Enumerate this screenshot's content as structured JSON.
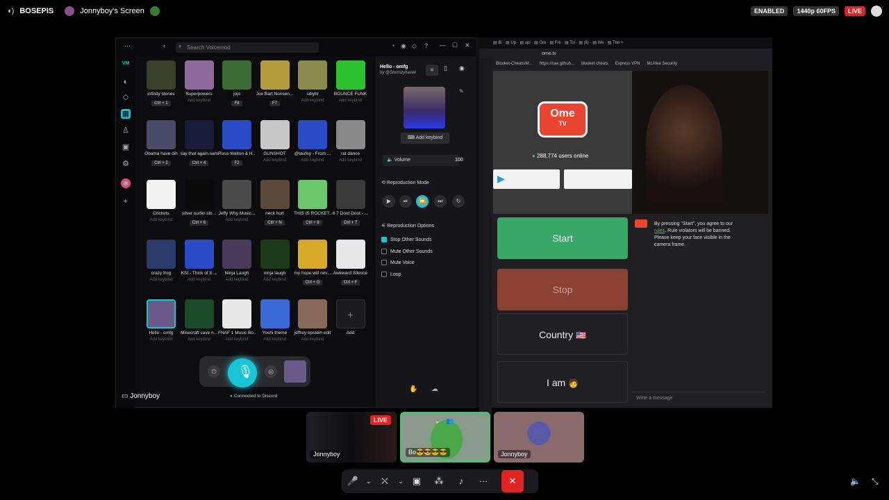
{
  "topbar": {
    "server_name": "BOSEPIS",
    "screen_title": "Jonnyboy's Screen",
    "enabled_badge": "ENABLED",
    "quality_badge": "1440p 60FPS",
    "live_badge": "LIVE"
  },
  "voicemod": {
    "search_placeholder": "Search Voicemod",
    "sounds": [
      {
        "name": "infinity stones",
        "keybind": "Ctrl + 1",
        "has_key": true,
        "color": "#3a3f2a"
      },
      {
        "name": "Superpowers",
        "keybind": "Add keybind",
        "has_key": false,
        "color": "#8d6b9c"
      },
      {
        "name": "jojo",
        "keybind": "F8",
        "has_key": true,
        "color": "#3b6b35"
      },
      {
        "name": "Joe Bart Nonsen...",
        "keybind": "F7",
        "has_key": true,
        "color": "#b59b3b"
      },
      {
        "name": "sdiybt",
        "keybind": "Add keybind",
        "has_key": false,
        "color": "#8a8a4a"
      },
      {
        "name": "BOUNCE FUNK",
        "keybind": "Add keybind",
        "has_key": false,
        "color": "#2ec12e"
      },
      {
        "name": "Obama have dih",
        "keybind": "Ctrl + 2",
        "has_key": true,
        "color": "#4a4a6a"
      },
      {
        "name": "say that again.sam",
        "keybind": "Ctrl + 4",
        "has_key": true,
        "color": "#1a1a3a"
      },
      {
        "name": "Rosa Walton & H...",
        "keybind": "F2",
        "has_key": true,
        "color": "#2a4ac8"
      },
      {
        "name": "GUNSHOT",
        "keybind": "Add keybind",
        "has_key": false,
        "color": "#c8c8c8"
      },
      {
        "name": "@taufey - From ...",
        "keybind": "Add keybind",
        "has_key": false,
        "color": "#2a4ac8"
      },
      {
        "name": "rat dance",
        "keybind": "Add keybind",
        "has_key": false,
        "color": "#8a8a8a"
      },
      {
        "name": "Crickets",
        "keybind": "Add keybind",
        "has_key": false,
        "color": "#f2f2f2"
      },
      {
        "name": "silver surfer slo...",
        "keybind": "Ctrl + 6",
        "has_key": true,
        "color": "#0a0a0a"
      },
      {
        "name": "Jeffy Why Music...",
        "keybind": "Add keybind",
        "has_key": false,
        "color": "#4a4a4a"
      },
      {
        "name": "neck hurt",
        "keybind": "Ctrl + N",
        "has_key": true,
        "color": "#5a4a3a"
      },
      {
        "name": "THIS IS ROCKET...",
        "keybind": "Ctrl + 8",
        "has_key": true,
        "color": "#6ac86a"
      },
      {
        "name": "6 7 Doot Doot - ...",
        "keybind": "Ctrl + 7",
        "has_key": true,
        "color": "#3a3a3a"
      },
      {
        "name": "crazy frog",
        "keybind": "Add keybind",
        "has_key": false,
        "color": "#2a3a6a"
      },
      {
        "name": "KSI - Thick of It ...",
        "keybind": "Add keybind",
        "has_key": false,
        "color": "#2a4ac8"
      },
      {
        "name": "Ninja Laugh",
        "keybind": "Add keybind",
        "has_key": false,
        "color": "#4a3a5a"
      },
      {
        "name": "ninja laugh",
        "keybind": "Add keybind",
        "has_key": false,
        "color": "#1a3a1a"
      },
      {
        "name": "my hope will nev...",
        "keybind": "Ctrl + G",
        "has_key": true,
        "color": "#d8a82a"
      },
      {
        "name": "Awkward Silence",
        "keybind": "Ctrl + F",
        "has_key": true,
        "color": "#e8e8e8"
      },
      {
        "name": "Hello - omfg",
        "keybind": "Add keybind",
        "has_key": false,
        "color": "#6a5a8a"
      },
      {
        "name": "Minecraft cave n...",
        "keybind": "Add keybind",
        "has_key": false,
        "color": "#1a4a2a"
      },
      {
        "name": "FNAF 1 Music Bo...",
        "keybind": "Add keybind",
        "has_key": false,
        "color": "#e8e8e8"
      },
      {
        "name": "Yoshi theme",
        "keybind": "Add keybind",
        "has_key": false,
        "color": "#3a6ad8"
      },
      {
        "name": "jeffrey epstein edit",
        "keybind": "Add keybind",
        "has_key": false,
        "color": "#8a6a5a"
      },
      {
        "name": "Add",
        "keybind": "",
        "has_key": false,
        "color": "#1c1c20"
      }
    ],
    "detail": {
      "title": "Hello - omfg",
      "author": "by @Stormzyhavok",
      "add_keybind": "Add keybind",
      "volume_label": "Volume",
      "volume_value": "100",
      "reproduction_mode": "Reproduction Mode",
      "reproduction_options": "Reproduction Options",
      "options": [
        {
          "label": "Stop Other Sounds",
          "checked": true
        },
        {
          "label": "Mute Other Sounds",
          "checked": false
        },
        {
          "label": "Mute Voice",
          "checked": false
        },
        {
          "label": "Loop",
          "checked": false
        }
      ]
    },
    "user_label": "Jonnyboy",
    "connected_label": "Connected to Discord"
  },
  "browser": {
    "url": "ome.tv",
    "bookmarks": [
      "Blooket-Cheats/M...",
      "https://raw.github...",
      "blooket cheats",
      "Express VPN",
      "McAfee Security"
    ],
    "logo_top": "Ome",
    "logo_bottom": "TV",
    "users_online": "288,774 users online",
    "buttons": {
      "start": "Start",
      "stop": "Stop",
      "country": "Country",
      "iam": "I am"
    },
    "rules_text_1": "By pressing \"Start\", you agree to our",
    "rules_link": "rules",
    "rules_text_2": ". Rule violators will be banned. Please keep your face visible in the camera frame.",
    "message_placeholder": "Write a message"
  },
  "participants": [
    {
      "name": "Jonnyboy"
    },
    {
      "name": "Bo😎😎😎😎"
    },
    {
      "name": "Jonnyboy"
    }
  ],
  "colors": {
    "accent": "#19c4d4",
    "start_green": "#3aa668",
    "stop_red": "#8a4032",
    "live_red": "#e02424"
  }
}
